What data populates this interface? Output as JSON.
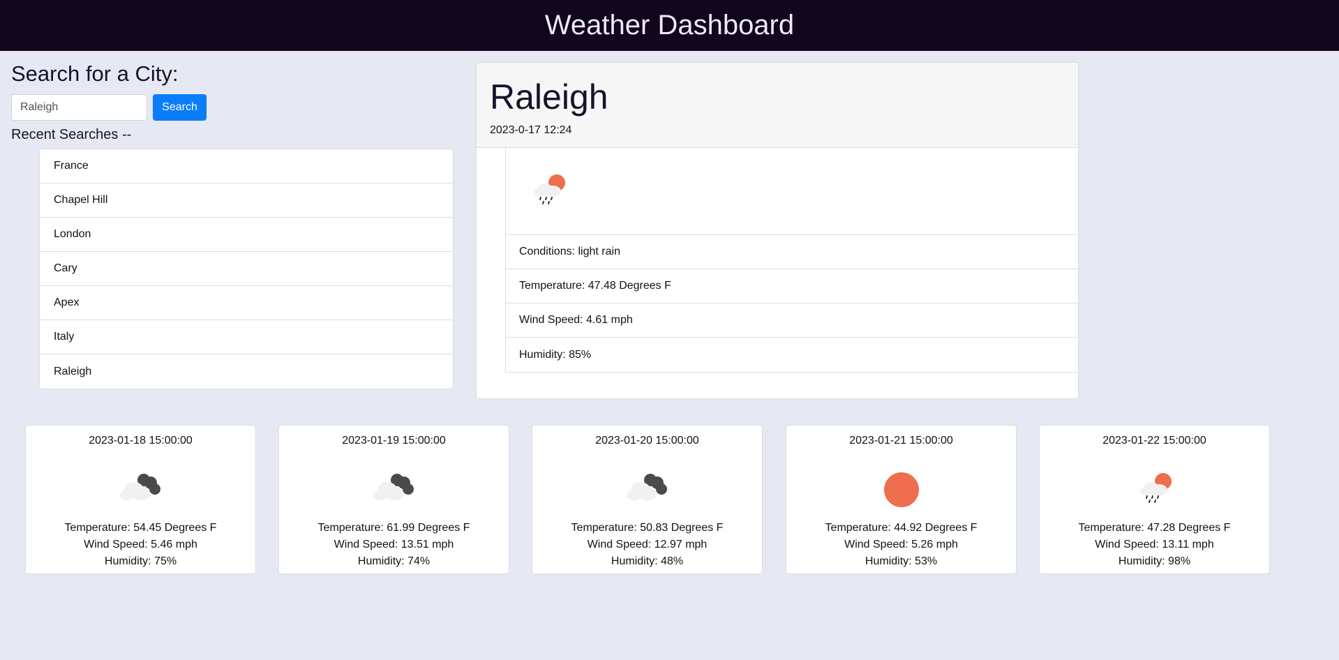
{
  "header": {
    "title": "Weather Dashboard"
  },
  "search": {
    "title": "Search for a City:",
    "input_value": "Raleigh",
    "button_label": "Search",
    "recent_label": "Recent Searches --",
    "recent": [
      "France",
      "Chapel Hill",
      "London",
      "Cary",
      "Apex",
      "Italy",
      "Raleigh"
    ]
  },
  "current": {
    "city": "Raleigh",
    "datetime": "2023-0-17 12:24",
    "icon": "cloud-sun-rain-icon",
    "conditions": "Conditions: light rain",
    "temperature": "Temperature: 47.48 Degrees F",
    "wind": "Wind Speed: 4.61 mph",
    "humidity": "Humidity: 85%"
  },
  "forecast": [
    {
      "date": "2023-01-18 15:00:00",
      "icon": "broken-clouds-icon",
      "temperature": "Temperature: 54.45 Degrees F",
      "wind": "Wind Speed: 5.46 mph",
      "humidity": "Humidity: 75%"
    },
    {
      "date": "2023-01-19 15:00:00",
      "icon": "broken-clouds-icon",
      "temperature": "Temperature: 61.99 Degrees F",
      "wind": "Wind Speed: 13.51 mph",
      "humidity": "Humidity: 74%"
    },
    {
      "date": "2023-01-20 15:00:00",
      "icon": "broken-clouds-icon",
      "temperature": "Temperature: 50.83 Degrees F",
      "wind": "Wind Speed: 12.97 mph",
      "humidity": "Humidity: 48%"
    },
    {
      "date": "2023-01-21 15:00:00",
      "icon": "clear-sun-icon",
      "temperature": "Temperature: 44.92 Degrees F",
      "wind": "Wind Speed: 5.26 mph",
      "humidity": "Humidity: 53%"
    },
    {
      "date": "2023-01-22 15:00:00",
      "icon": "cloud-sun-rain-icon",
      "temperature": "Temperature: 47.28 Degrees F",
      "wind": "Wind Speed: 13.11 mph",
      "humidity": "Humidity: 98%"
    }
  ],
  "colors": {
    "header_bg": "#12051e",
    "page_bg": "#e6e9f3",
    "accent": "#0b7dfa",
    "sun": "#ee6e4d",
    "dark_cloud": "#4a4a4a",
    "light_cloud": "#f1f1f1"
  }
}
